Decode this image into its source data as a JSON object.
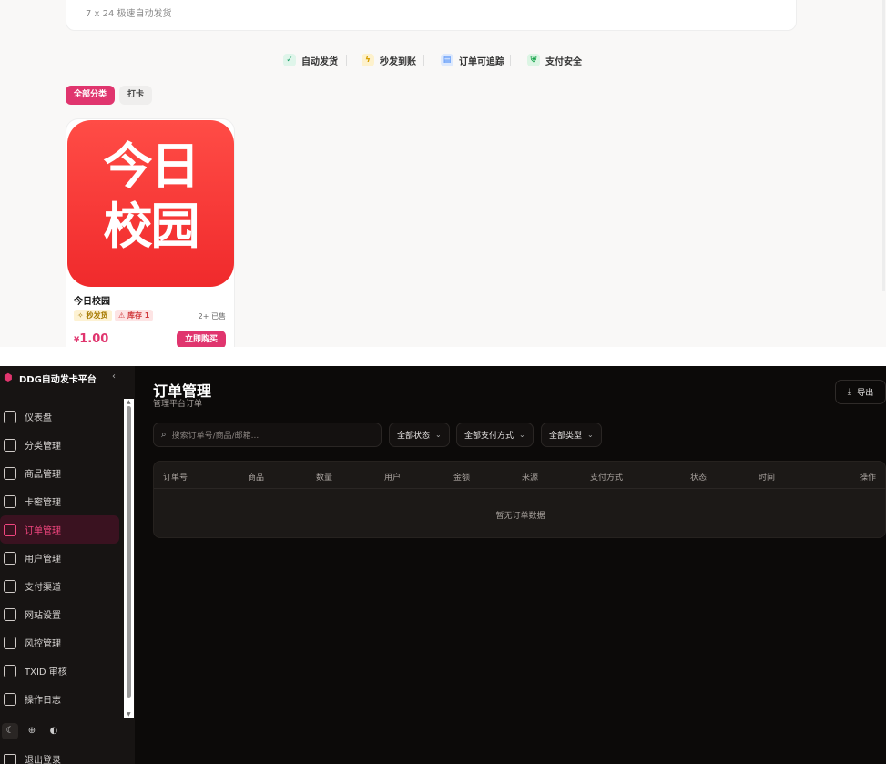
{
  "storefront": {
    "top_card_text": "7 x 24 极速自动发货",
    "features": [
      {
        "label": "自动发货",
        "icon": "check-icon",
        "color": "#22a06b"
      },
      {
        "label": "秒发到账",
        "icon": "lightning-icon",
        "color": "#d69e00"
      },
      {
        "label": "订单可追踪",
        "icon": "document-icon",
        "color": "#3b82f6"
      },
      {
        "label": "支付安全",
        "icon": "shield-icon",
        "color": "#16a34a"
      }
    ],
    "categories": [
      "全部分类",
      "打卡"
    ],
    "product": {
      "image_text_line1": "今日",
      "image_text_line2": "校园",
      "name": "今日校园",
      "badge_fast": "✧ 秒发货",
      "badge_stock": "⚠ 库存 1",
      "sold": "2+ 已售",
      "price_symbol": "¥",
      "price": "1.00",
      "buy_label": "立即购买"
    }
  },
  "admin": {
    "brand": "DDG自动发卡平台",
    "collapse_icon": "chevron-left-icon",
    "nav": [
      {
        "label": "仪表盘",
        "icon": "dashboard-icon",
        "active": false
      },
      {
        "label": "分类管理",
        "icon": "category-icon",
        "active": false
      },
      {
        "label": "商品管理",
        "icon": "box-icon",
        "active": false
      },
      {
        "label": "卡密管理",
        "icon": "key-icon",
        "active": false
      },
      {
        "label": "订单管理",
        "icon": "cart-icon",
        "active": true
      },
      {
        "label": "用户管理",
        "icon": "users-icon",
        "active": false
      },
      {
        "label": "支付渠道",
        "icon": "credit-card-icon",
        "active": false
      },
      {
        "label": "网站设置",
        "icon": "gear-icon",
        "active": false
      },
      {
        "label": "风控管理",
        "icon": "shield-icon",
        "active": false
      },
      {
        "label": "TXID 审核",
        "icon": "txid-icon",
        "active": false
      },
      {
        "label": "操作日志",
        "icon": "log-icon",
        "active": false
      }
    ],
    "footer_icons": [
      "moon-icon",
      "globe-icon",
      "palette-icon"
    ],
    "logout": "退出登录",
    "page_title": "订单管理",
    "page_subtitle": "管理平台订单",
    "export_label": "导出",
    "search_placeholder": "搜索订单号/商品/邮箱...",
    "filters": [
      "全部状态",
      "全部支付方式",
      "全部类型"
    ],
    "columns": [
      "订单号",
      "商品",
      "数量",
      "用户",
      "金额",
      "来源",
      "支付方式",
      "状态",
      "时间",
      "操作"
    ],
    "empty_text": "暂无订单数据",
    "accent": "#e0356e"
  }
}
